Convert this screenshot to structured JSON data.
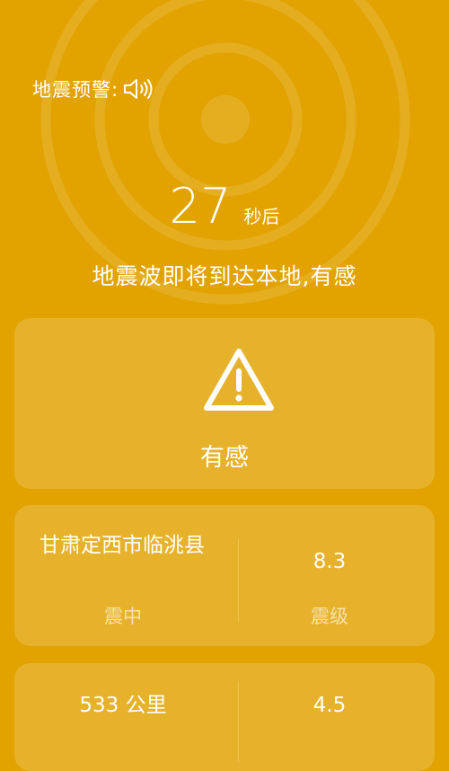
{
  "warning": {
    "label": "地震预警:",
    "sound_icon": "speaker-icon"
  },
  "countdown": {
    "seconds": "27",
    "unit": "秒后"
  },
  "message": "地震波即将到达本地,有感",
  "intensity": {
    "icon": "warning-triangle-icon",
    "label": "有感"
  },
  "epicenter": {
    "value": "甘肃定西市临洮县",
    "label": "震中"
  },
  "magnitude": {
    "value": "8.3",
    "label": "震级"
  },
  "distance": {
    "value": "533 公里"
  },
  "local_intensity": {
    "value": "4.5"
  },
  "colors": {
    "background": "#e2a300",
    "card": "rgba(255,255,255,0.17)",
    "text": "#ffffff"
  }
}
